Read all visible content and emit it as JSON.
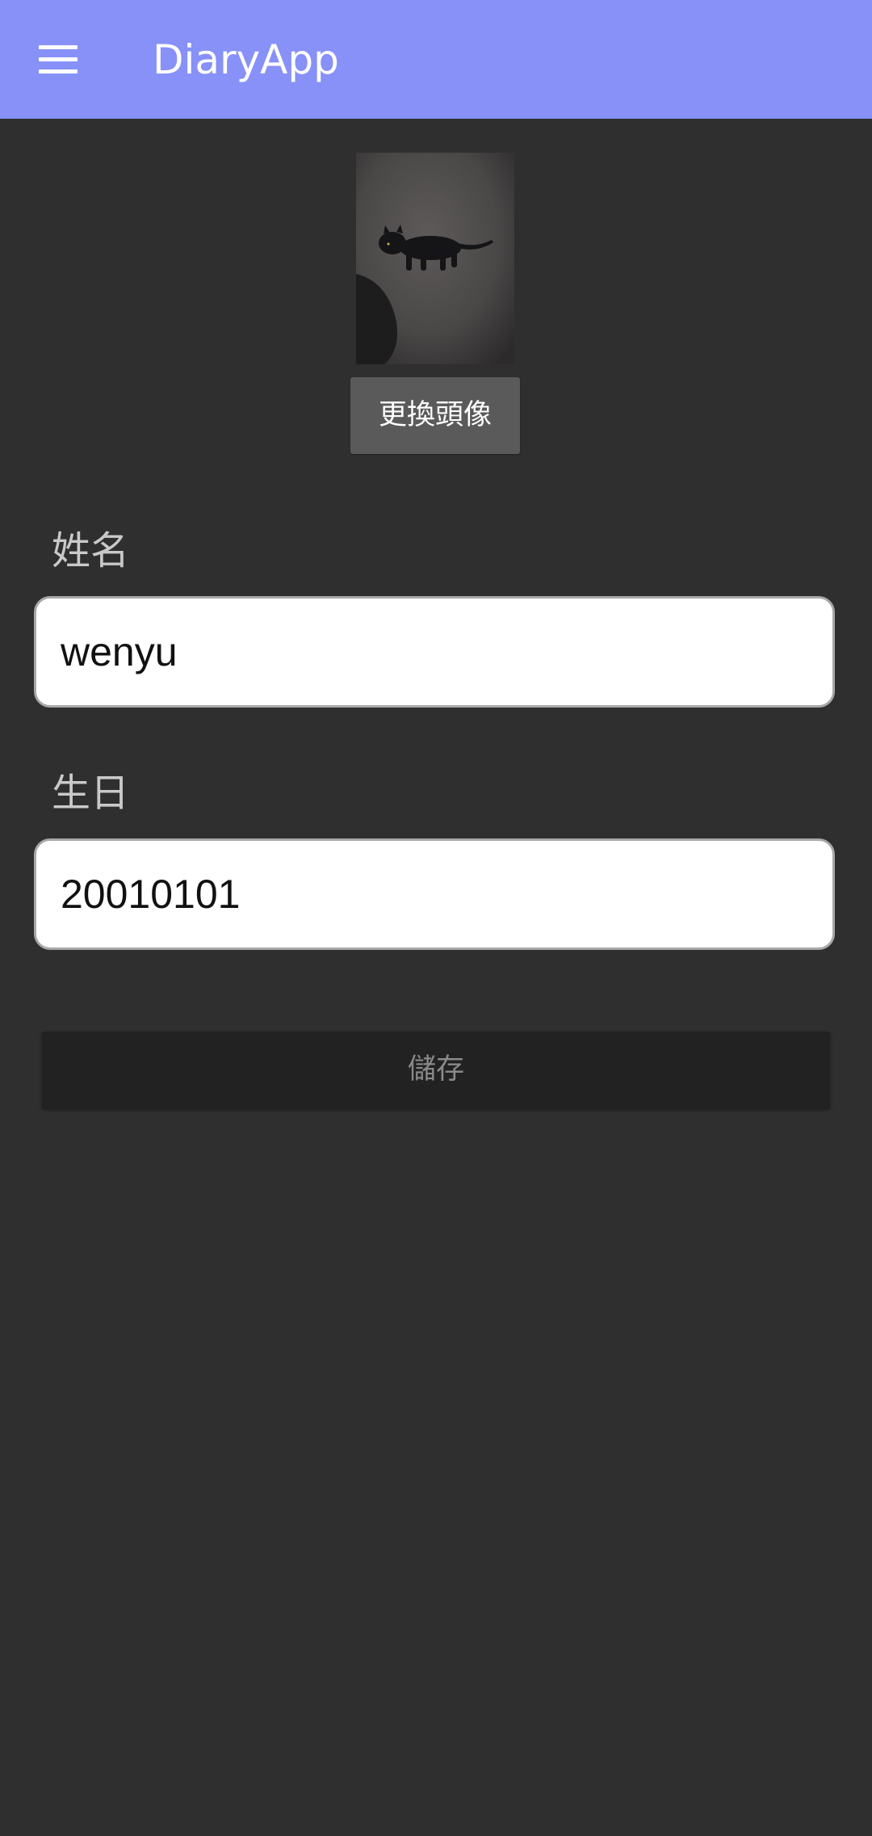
{
  "app_bar": {
    "title": "DiaryApp",
    "menu_icon": "hamburger-menu-icon",
    "background_color": "#8791f7"
  },
  "profile": {
    "avatar_image": "black cat lying on pavement",
    "change_avatar_label": "更換頭像"
  },
  "form": {
    "name_label": "姓名",
    "name_value": "wenyu",
    "birthday_label": "生日",
    "birthday_value": "20010101",
    "save_label": "儲存"
  },
  "colors": {
    "page_background": "#2f2f2f",
    "button_gray": "#5a5a5a",
    "save_button_disabled": "#222222"
  }
}
